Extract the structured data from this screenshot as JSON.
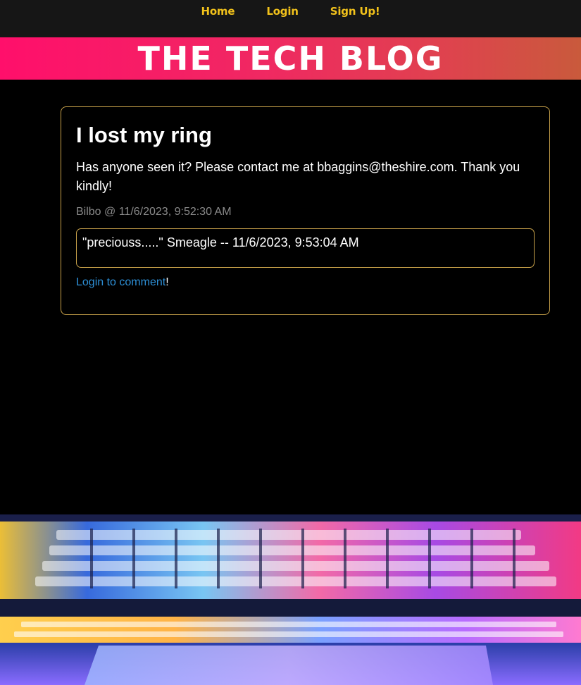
{
  "nav": {
    "home": "Home",
    "login": "Login",
    "signup": "Sign Up!"
  },
  "banner": {
    "title": "THE TECH BLOG"
  },
  "post": {
    "title": "I lost my ring",
    "body": "Has anyone seen it? Please contact me at bbaggins@theshire.com. Thank you kindly!",
    "meta": "Bilbo @ 11/6/2023, 9:52:30 AM",
    "comments": [
      {
        "text": "\"preciouss.....\" Smeagle -- 11/6/2023, 9:53:04 AM"
      }
    ],
    "login_link": "Login to comment",
    "login_suffix": "!"
  },
  "colors": {
    "nav_link": "#f2c21b",
    "card_border": "#c9a24a",
    "link": "#2d8fd6",
    "banner_start": "#ff0f6b",
    "banner_end": "#c95a3c"
  }
}
